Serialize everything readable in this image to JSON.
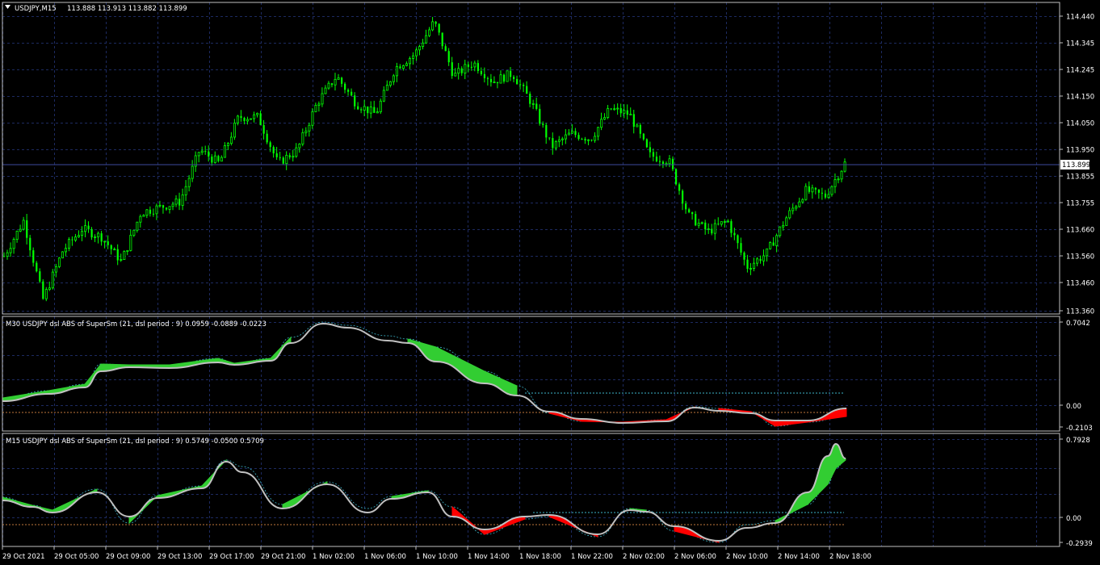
{
  "chart_title": {
    "symbol": "USDJPY,M15",
    "ohlc": "113.888 113.913 113.882 113.899"
  },
  "colors": {
    "background": "#000000",
    "grid": "#1d2a60",
    "frame": "#c0c0c0",
    "candle_bull": "#00ff00",
    "price_line": "#3d4a9c",
    "indicator_green": "#32cd32",
    "indicator_red": "#ff0000",
    "indicator_neutral": "#c0c0c0",
    "level_line": "#c0783c",
    "signal_line": "#3cb4c8"
  },
  "price_panel": {
    "current_price": "113.899",
    "scale_labels": [
      "114.440",
      "114.345",
      "114.245",
      "114.150",
      "114.050",
      "113.950",
      "113.855",
      "113.755",
      "113.660",
      "113.560",
      "113.460",
      "113.360"
    ]
  },
  "indicator_1": {
    "title": "M30 USDJPY  dsl ABS of SuperSm (21, dsl period : 9) 0.0959 -0.0889 -0.0223",
    "scale_labels": [
      "0.7042",
      "0.00",
      "-0.2103"
    ]
  },
  "indicator_2": {
    "title": "M15 USDJPY  dsl ABS of SuperSm (21, dsl period : 9) 0.5749 -0.0500 0.5709",
    "scale_labels": [
      "0.7928",
      "0.00",
      "-0.2939"
    ]
  },
  "time_axis": {
    "labels": [
      "29 Oct 2021",
      "29 Oct 05:00",
      "29 Oct 09:00",
      "29 Oct 13:00",
      "29 Oct 17:00",
      "29 Oct 21:00",
      "1 Nov 02:00",
      "1 Nov 06:00",
      "1 Nov 10:00",
      "1 Nov 14:00",
      "1 Nov 18:00",
      "1 Nov 22:00",
      "2 Nov 02:00",
      "2 Nov 06:00",
      "2 Nov 10:00",
      "2 Nov 14:00",
      "2 Nov 18:00"
    ]
  },
  "chart_data": {
    "type": "candlestick",
    "symbol": "USDJPY",
    "timeframe": "M15",
    "ylim": [
      113.36,
      114.44
    ],
    "close_path": [
      113.56,
      113.69,
      113.4,
      113.58,
      113.66,
      113.63,
      113.54,
      113.72,
      113.74,
      113.76,
      113.95,
      113.9,
      114.07,
      114.07,
      113.9,
      113.95,
      114.12,
      114.22,
      114.12,
      114.08,
      114.25,
      114.3,
      114.42,
      114.22,
      114.27,
      114.2,
      114.23,
      114.12,
      113.96,
      114.01,
      113.99,
      114.1,
      114.08,
      113.93,
      113.91,
      113.71,
      113.65,
      113.69,
      113.52,
      113.57,
      113.7,
      113.8,
      113.78,
      113.9
    ]
  }
}
